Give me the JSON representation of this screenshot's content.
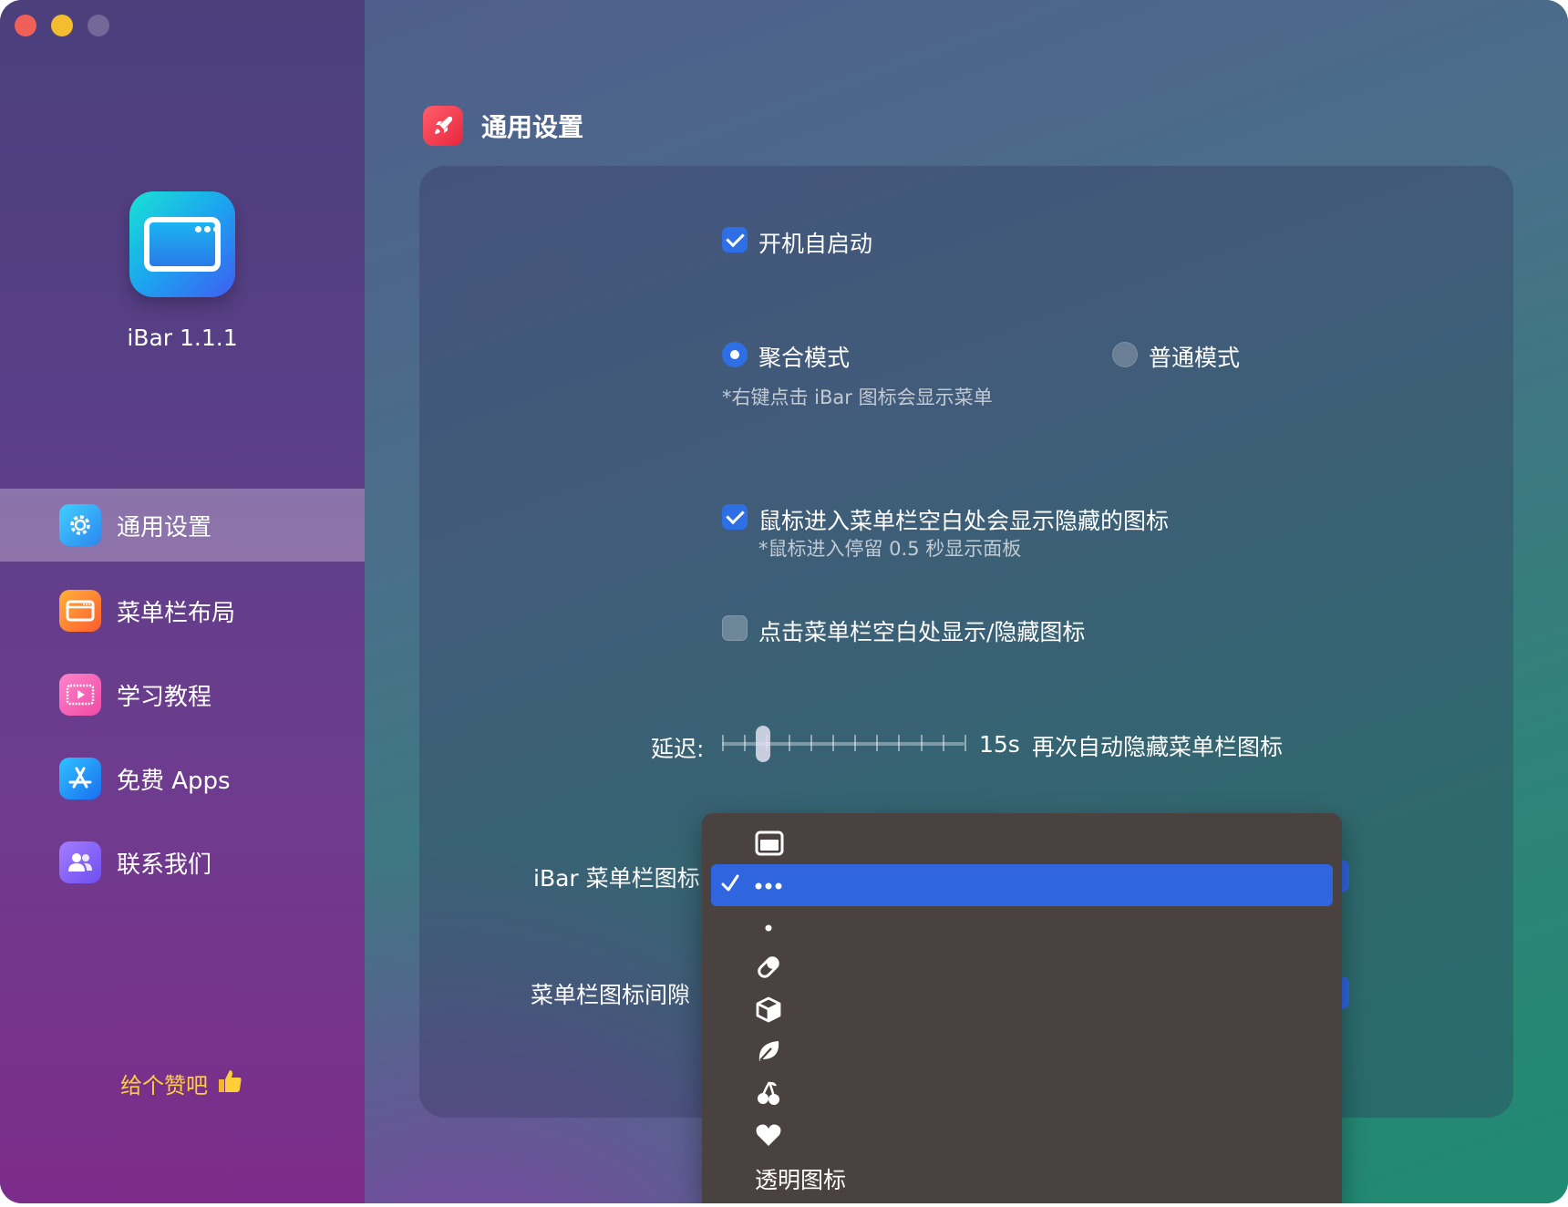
{
  "app": {
    "name": "iBar 1.1.1"
  },
  "sidebar": {
    "items": [
      {
        "label": "通用设置",
        "icon": "gear-icon",
        "active": true
      },
      {
        "label": "菜单栏布局",
        "icon": "menubar-layout-icon",
        "active": false
      },
      {
        "label": "学习教程",
        "icon": "video-tutorial-icon",
        "active": false
      },
      {
        "label": "免费 Apps",
        "icon": "app-store-icon",
        "active": false
      },
      {
        "label": "联系我们",
        "icon": "contacts-icon",
        "active": false
      }
    ],
    "like_label": "给个赞吧"
  },
  "section": {
    "title": "通用设置",
    "icon": "rocket-icon"
  },
  "settings": {
    "launch_at_login": {
      "label": "开机自启动",
      "checked": true
    },
    "mode": {
      "options": [
        {
          "label": "聚合模式",
          "selected": true
        },
        {
          "label": "普通模式",
          "selected": false
        }
      ],
      "note": "*右键点击 iBar 图标会显示菜单"
    },
    "hover_show": {
      "label": "鼠标进入菜单栏空白处会显示隐藏的图标",
      "note": "*鼠标进入停留 0.5 秒显示面板",
      "checked": true
    },
    "click_toggle": {
      "label": "点击菜单栏空白处显示/隐藏图标",
      "checked": false
    },
    "delay": {
      "label": "延迟:",
      "value": "15s",
      "suffix": "再次自动隐藏菜单栏图标",
      "level": 0.17
    },
    "menubar_icon": {
      "label": "iBar 菜单栏图标"
    },
    "icon_spacing": {
      "label": "菜单栏图标间隙"
    }
  },
  "menu": {
    "items": [
      {
        "icon": "window-icon",
        "selected": false
      },
      {
        "icon": "ellipsis-icon",
        "selected": true
      },
      {
        "icon": "dot-icon",
        "selected": false
      },
      {
        "icon": "pill-icon",
        "selected": false
      },
      {
        "icon": "cube-icon",
        "selected": false
      },
      {
        "icon": "leaf-icon",
        "selected": false
      },
      {
        "icon": "cherries-icon",
        "selected": false
      },
      {
        "icon": "heart-icon",
        "selected": false
      }
    ],
    "transparent_label": "透明图标"
  },
  "colors": {
    "accent": "#2f66e0",
    "like": "#ffcf3a",
    "close": "#ed5f57",
    "minimize": "#f4bd2f"
  }
}
